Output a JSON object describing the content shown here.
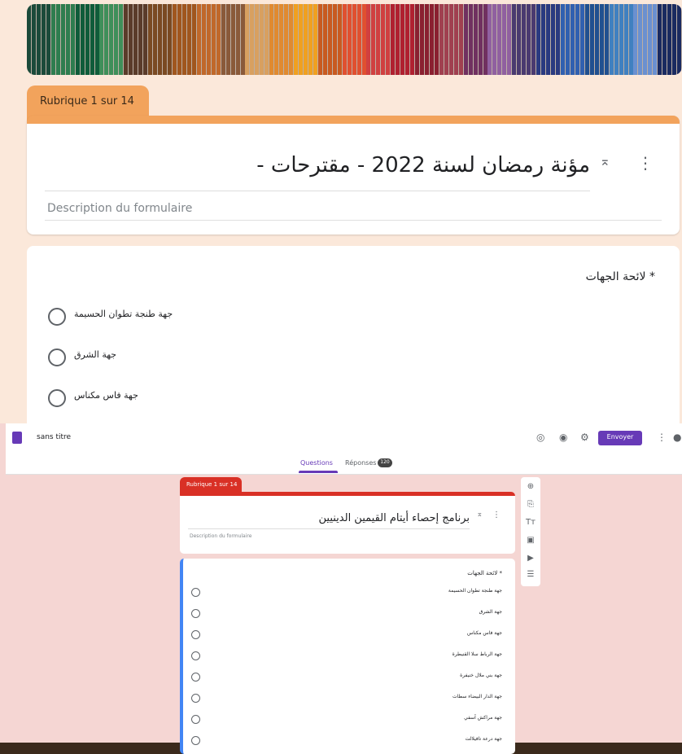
{
  "top": {
    "section_tab": "Rubrique 1 sur 14",
    "form_title": "مؤنة رمضان لسنة 2022 - مقترحات -",
    "description_placeholder": "Description du formulaire",
    "collapse_icon": "collapse-icon",
    "more_icon": "more-vert-icon",
    "question": {
      "title": "* لائحة الجهات",
      "options": [
        "جهة طنجة تطوان الحسيمة",
        "جهة الشرق",
        "جهة فاس مكناس"
      ]
    }
  },
  "bottom": {
    "app_bar": {
      "doc_name": "sans titre",
      "send_label": "Envoyer",
      "icons": [
        "palette-icon",
        "eye-icon",
        "settings-icon"
      ]
    },
    "tabs": {
      "questions": "Questions",
      "responses": "Réponses",
      "responses_count": "120"
    },
    "section_tab": "Rubrique 1 sur 14",
    "form_title": "برنامج إحصاء أيتام القيمين الدينيين",
    "description_placeholder": "Description du formulaire",
    "question": {
      "title": "* لائحة الجهات",
      "options": [
        "جهة طنجة تطوان الحسيمة",
        "جهة الشرق",
        "جهة فاس مكناس",
        "جهة الرباط سلا القنيطرة",
        "جهة بني ملال خنيفرة",
        "جهة الدار البيضاء سطات",
        "جهة مراكش آسفي",
        "جهة درعة تافيلالت"
      ]
    },
    "toolbar_icons": [
      "add-question-icon",
      "import-icon",
      "title-icon",
      "image-icon",
      "video-icon",
      "section-icon"
    ]
  },
  "colors": {
    "orange_accent": "#f2a35c",
    "red_accent": "#d93025",
    "purple": "#673ab7",
    "blue_focus": "#4285f4"
  }
}
